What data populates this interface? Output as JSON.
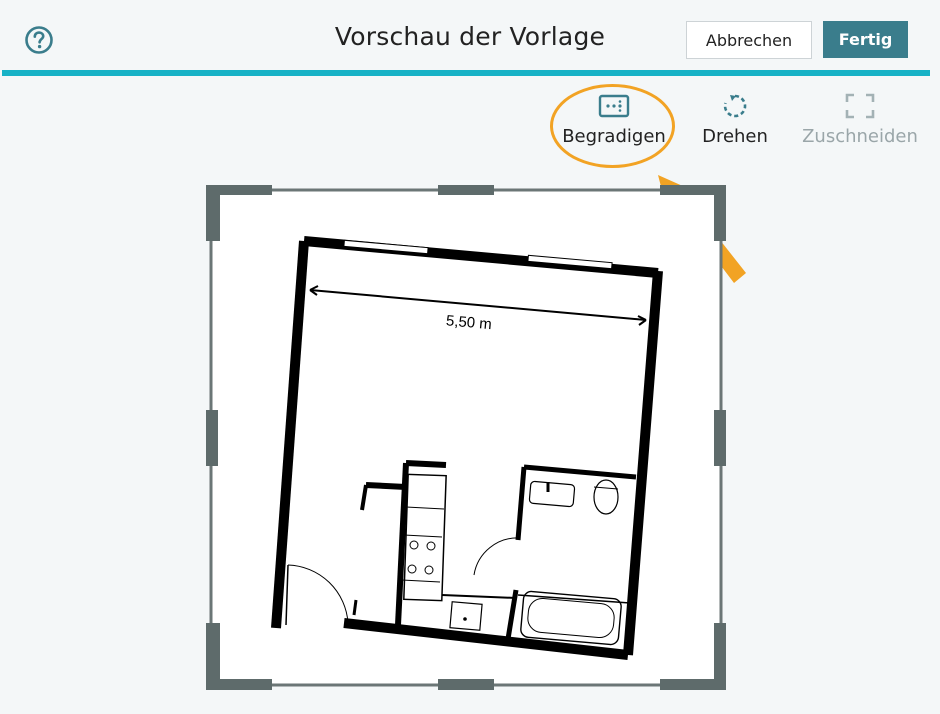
{
  "header": {
    "title": "Vorschau der Vorlage",
    "help_icon": "help-circle-icon",
    "cancel_label": "Abbrechen",
    "done_label": "Fertig"
  },
  "toolbar": {
    "straighten": {
      "label": "Begradigen",
      "icon": "straighten-icon",
      "highlighted": true
    },
    "rotate": {
      "label": "Drehen",
      "icon": "rotate-icon"
    },
    "crop": {
      "label": "Zuschneiden",
      "icon": "crop-icon",
      "disabled": true
    }
  },
  "floorplan": {
    "dimension_label": "5,50 m"
  },
  "colors": {
    "accent": "#3a7d8c",
    "header_bar": "#17b2c6",
    "highlight": "#f2a324",
    "frame": "#5e6b6b"
  }
}
